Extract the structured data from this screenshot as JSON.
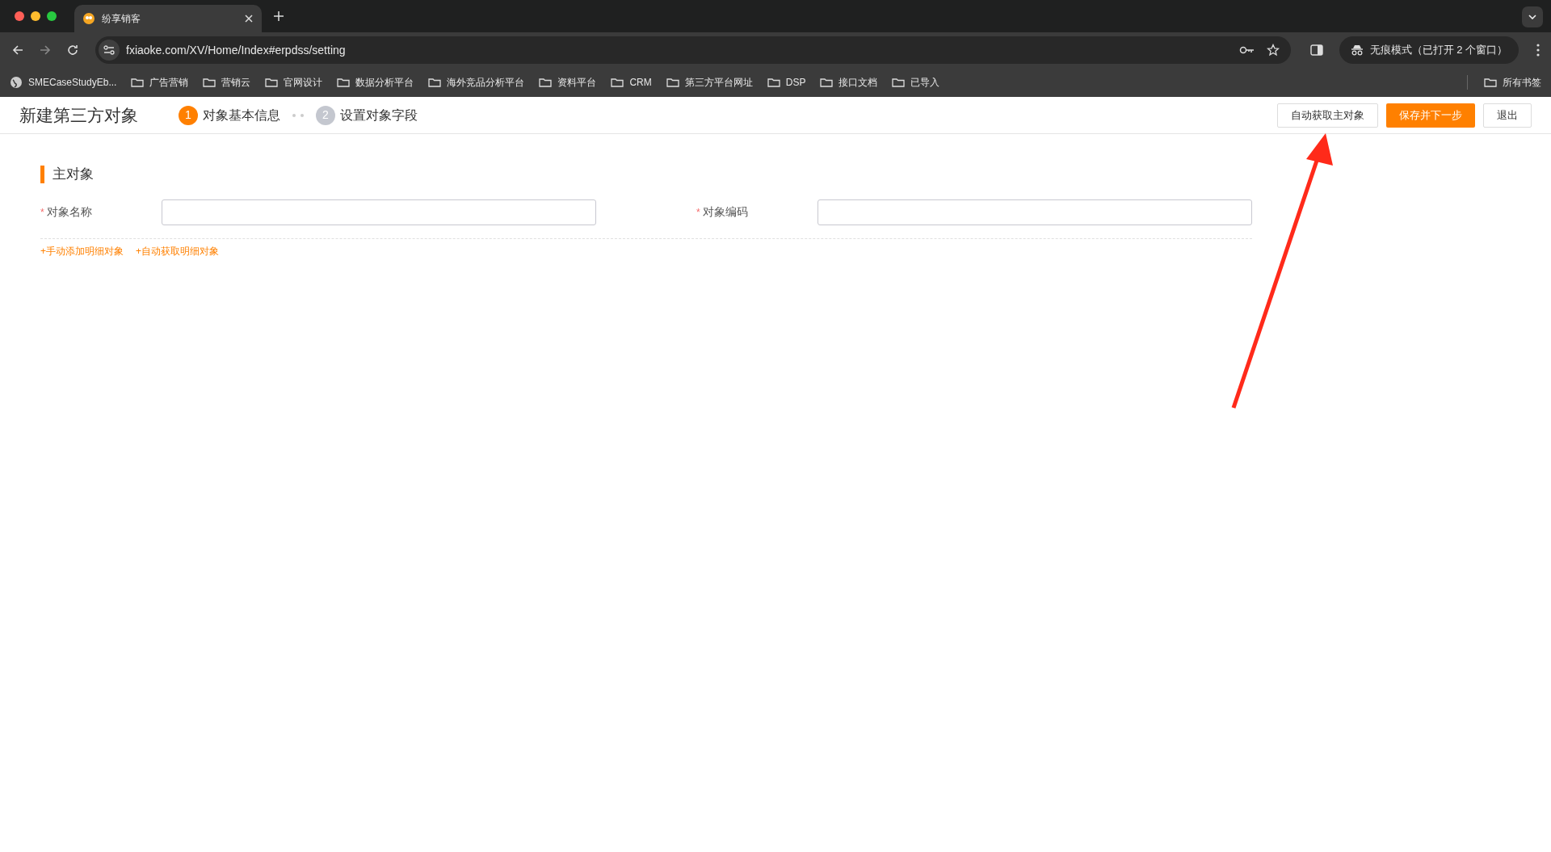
{
  "browser": {
    "tab_title": "纷享销客",
    "url": "fxiaoke.com/XV/Home/Index#erpdss/setting",
    "incognito_label": "无痕模式（已打开 2 个窗口）",
    "bookmarks": [
      {
        "kind": "site",
        "label": "SMECaseStudyEb..."
      },
      {
        "kind": "folder",
        "label": "广告营销"
      },
      {
        "kind": "folder",
        "label": "营销云"
      },
      {
        "kind": "folder",
        "label": "官网设计"
      },
      {
        "kind": "folder",
        "label": "数据分析平台"
      },
      {
        "kind": "folder",
        "label": "海外竞品分析平台"
      },
      {
        "kind": "folder",
        "label": "资料平台"
      },
      {
        "kind": "folder",
        "label": "CRM"
      },
      {
        "kind": "folder",
        "label": "第三方平台网址"
      },
      {
        "kind": "folder",
        "label": "DSP"
      },
      {
        "kind": "folder",
        "label": "接口文档"
      },
      {
        "kind": "folder",
        "label": "已导入"
      }
    ],
    "all_bookmarks": "所有书签"
  },
  "header": {
    "title": "新建第三方对象",
    "steps": [
      {
        "number": "1",
        "label": "对象基本信息",
        "selected": true
      },
      {
        "number": "2",
        "label": "设置对象字段",
        "selected": false
      }
    ],
    "buttons": [
      {
        "kind": "default",
        "label": "自动获取主对象"
      },
      {
        "kind": "primary",
        "label": "保存并下一步"
      },
      {
        "kind": "default",
        "label": "退出"
      }
    ]
  },
  "section": {
    "title": "主对象",
    "fields": [
      {
        "label": "对象名称",
        "required_mark": "*"
      },
      {
        "label": "对象编码",
        "required_mark": "*"
      }
    ],
    "links": [
      "+手动添加明细对象",
      "+自动获取明细对象"
    ]
  }
}
